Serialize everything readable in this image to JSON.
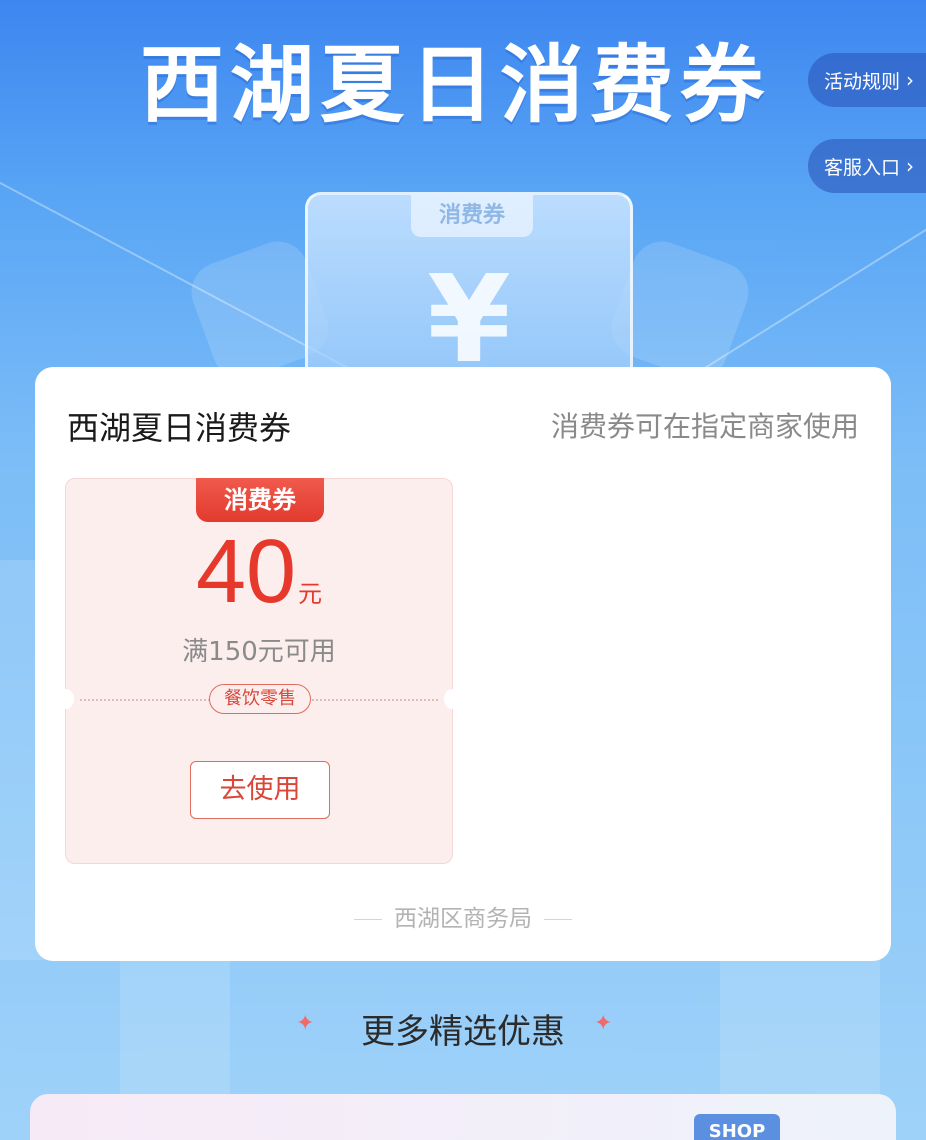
{
  "hero": {
    "title": "西湖夏日消费券",
    "ticket_tag": "消费券",
    "ticket_symbol": "¥"
  },
  "side_actions": [
    {
      "label": "活动规则",
      "icon": "chevron-right-icon"
    },
    {
      "label": "客服入口",
      "icon": "chevron-right-icon"
    }
  ],
  "card": {
    "title": "西湖夏日消费券",
    "subtitle": "消费券可在指定商家使用",
    "coupon": {
      "badge": "消费券",
      "amount": "40",
      "unit": "元",
      "condition": "满150元可用",
      "category": "餐饮零售",
      "action_label": "去使用"
    },
    "issuer": "西湖区商务局"
  },
  "more_section": {
    "title": "更多精选优惠"
  },
  "banner": {
    "shop_tag": "SHOP"
  },
  "colors": {
    "accent_red": "#e6392b",
    "page_blue": "#5aa6f5"
  }
}
